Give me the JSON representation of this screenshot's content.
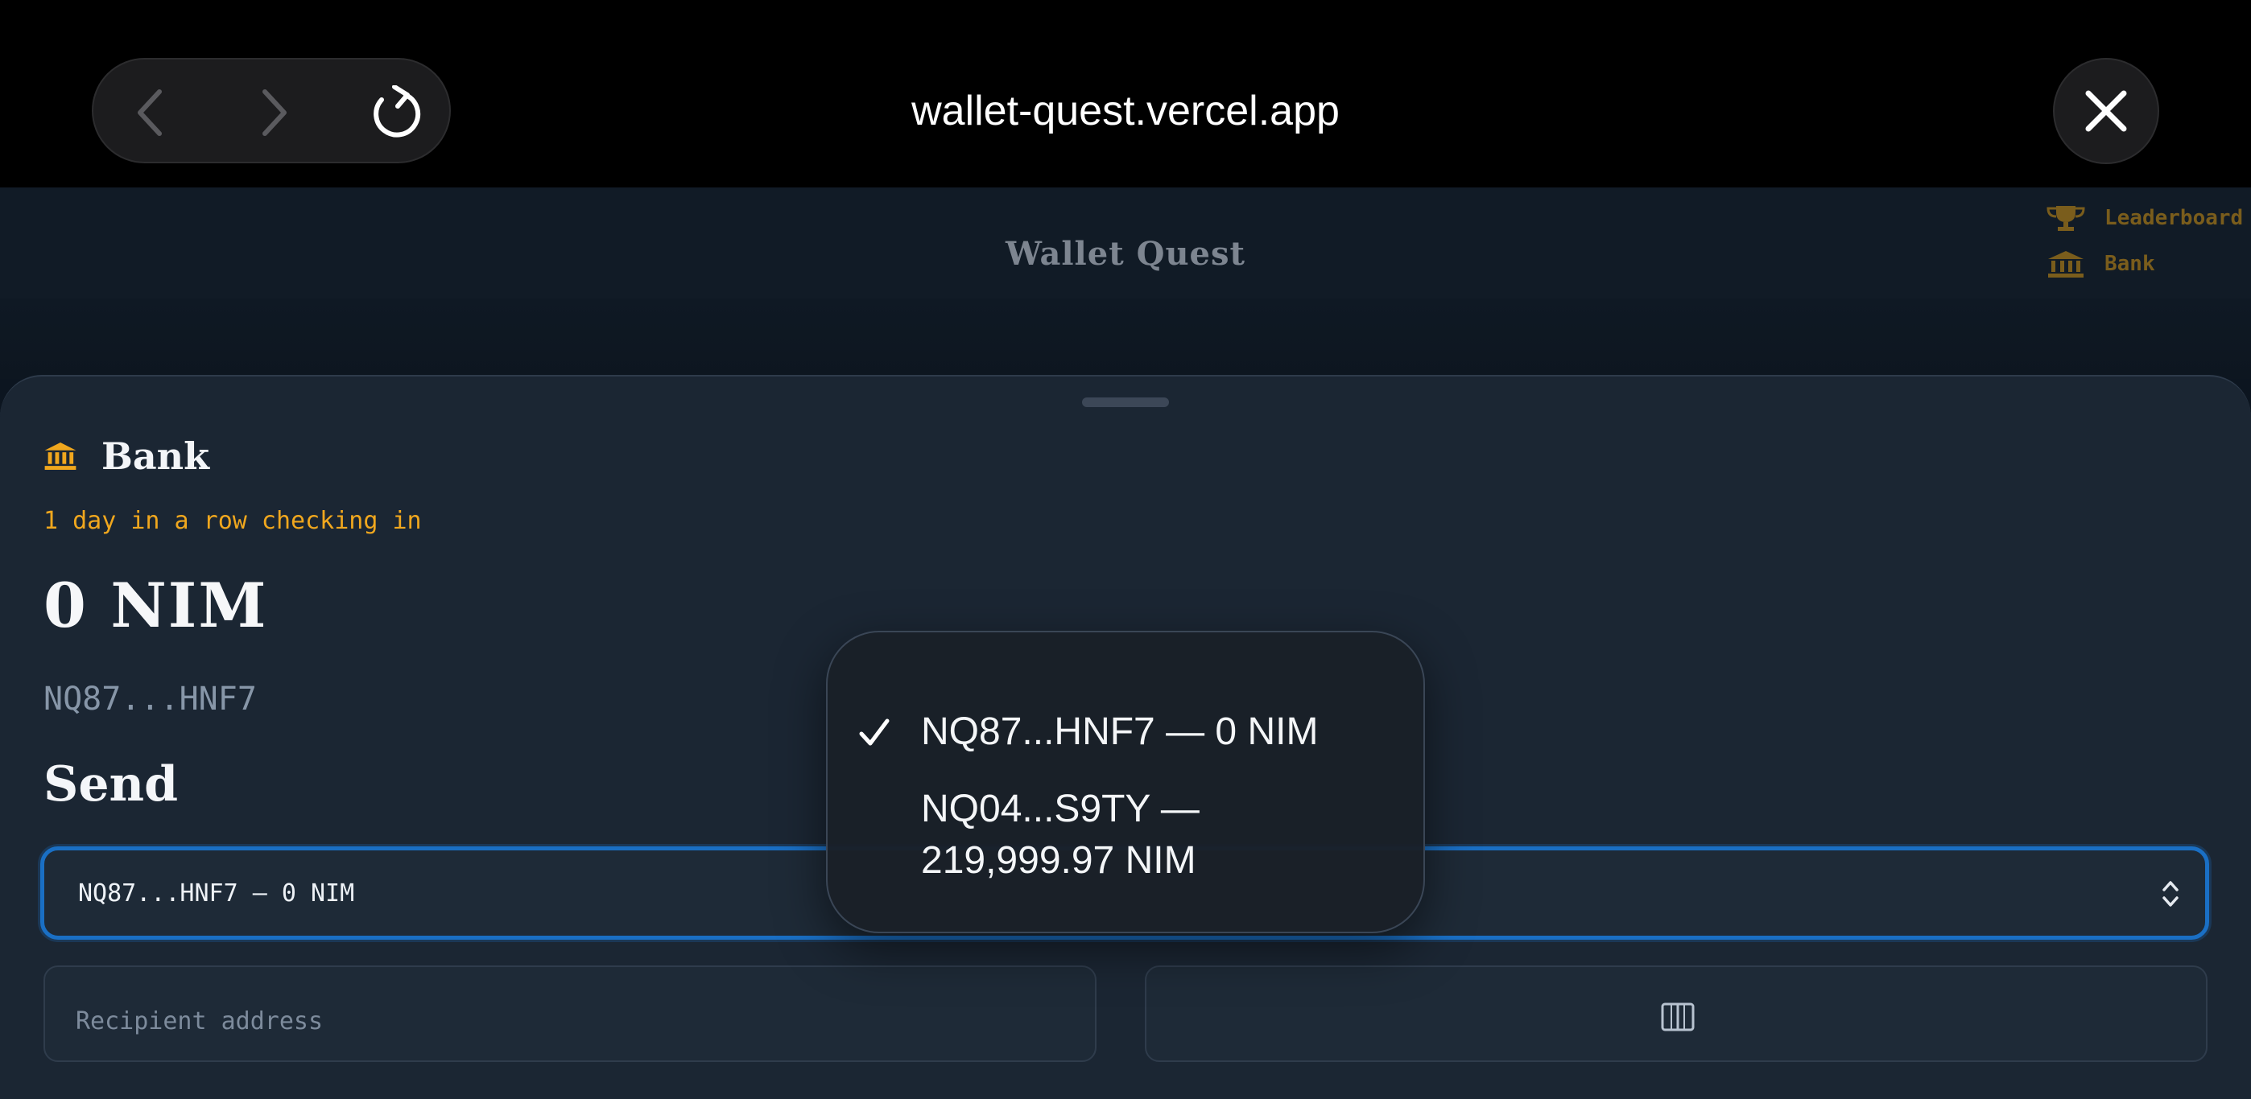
{
  "browser": {
    "url": "wallet-quest.vercel.app"
  },
  "app": {
    "title": "Wallet Quest",
    "links": [
      {
        "label": "Leaderboard",
        "icon": "trophy-icon"
      },
      {
        "label": "Bank",
        "icon": "bank-icon"
      }
    ]
  },
  "sheet": {
    "title": "Bank",
    "streak": "1 day in a row checking in",
    "balance": "0 NIM",
    "address": "NQ87...HNF7",
    "send_title": "Send",
    "selected_account": "NQ87...HNF7 — 0 NIM",
    "recipient_placeholder": "Recipient address",
    "scan_icon": "book-icon"
  },
  "dropdown": {
    "options": [
      {
        "label": "NQ87...HNF7 — 0 NIM",
        "selected": true
      },
      {
        "label": "NQ04...S9TY — 219,999.97 NIM",
        "selected": false
      }
    ]
  },
  "colors": {
    "accent": "#1a6fc4",
    "gold": "#f0a71e",
    "sheet_bg": "#1b2633"
  }
}
